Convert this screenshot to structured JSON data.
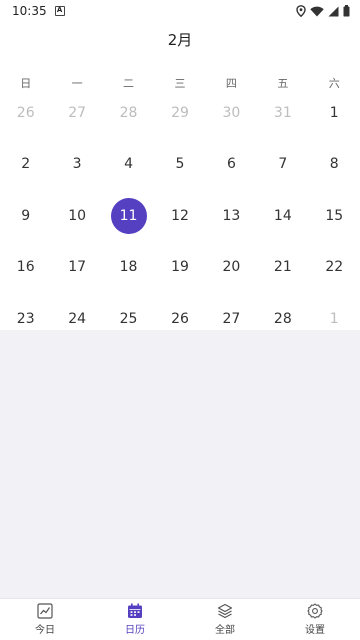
{
  "status_bar": {
    "time": "10:35",
    "notification_icon": "a-icon",
    "icons": [
      "location-icon",
      "wifi-icon",
      "signal-icon",
      "battery-icon"
    ]
  },
  "calendar": {
    "month_title": "2月",
    "weekdays": [
      "日",
      "一",
      "二",
      "三",
      "四",
      "五",
      "六"
    ],
    "weeks": [
      [
        {
          "d": "26",
          "muted": true
        },
        {
          "d": "27",
          "muted": true
        },
        {
          "d": "28",
          "muted": true
        },
        {
          "d": "29",
          "muted": true
        },
        {
          "d": "30",
          "muted": true
        },
        {
          "d": "31",
          "muted": true
        },
        {
          "d": "1"
        }
      ],
      [
        {
          "d": "2"
        },
        {
          "d": "3"
        },
        {
          "d": "4"
        },
        {
          "d": "5"
        },
        {
          "d": "6"
        },
        {
          "d": "7"
        },
        {
          "d": "8"
        }
      ],
      [
        {
          "d": "9"
        },
        {
          "d": "10"
        },
        {
          "d": "11",
          "selected": true
        },
        {
          "d": "12"
        },
        {
          "d": "13"
        },
        {
          "d": "14"
        },
        {
          "d": "15"
        }
      ],
      [
        {
          "d": "16"
        },
        {
          "d": "17"
        },
        {
          "d": "18"
        },
        {
          "d": "19"
        },
        {
          "d": "20"
        },
        {
          "d": "21"
        },
        {
          "d": "22"
        }
      ],
      [
        {
          "d": "23"
        },
        {
          "d": "24"
        },
        {
          "d": "25"
        },
        {
          "d": "26"
        },
        {
          "d": "27"
        },
        {
          "d": "28"
        },
        {
          "d": "1",
          "muted": true
        }
      ]
    ],
    "accent_color": "#5540c2"
  },
  "bottom_nav": {
    "items": [
      {
        "label": "今日",
        "icon": "chart-icon",
        "active": false
      },
      {
        "label": "日历",
        "icon": "calendar-icon",
        "active": true
      },
      {
        "label": "全部",
        "icon": "layers-icon",
        "active": false
      },
      {
        "label": "设置",
        "icon": "gear-icon",
        "active": false
      }
    ]
  }
}
